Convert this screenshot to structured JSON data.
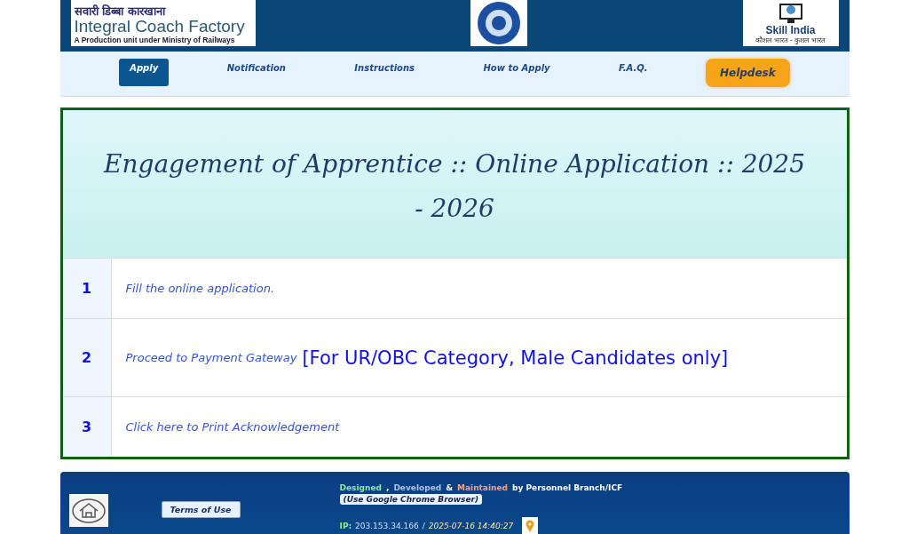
{
  "header": {
    "hindi_title": "सवारी डिब्बा कारखाना",
    "title": "Integral Coach Factory",
    "subtitle": "A Production unit under Ministry of Railways",
    "skill_logo": {
      "name": "Skill India",
      "tagline": "कौशल भारत - कुशल भारत"
    }
  },
  "nav": [
    {
      "label": "Apply",
      "selected": true,
      "kind": "tab"
    },
    {
      "label": "Notification",
      "selected": false,
      "kind": "tab"
    },
    {
      "label": "Instructions",
      "selected": false,
      "kind": "tab"
    },
    {
      "label": "How to Apply",
      "selected": false,
      "kind": "tab"
    },
    {
      "label": "F.A.Q.",
      "selected": false,
      "kind": "tab"
    },
    {
      "label": "Helpdesk",
      "kind": "helpdesk"
    }
  ],
  "main": {
    "title": "Engagement of Apprentice :: Online Application :: 2025 - 2026",
    "steps": [
      {
        "number": "1",
        "link": "Fill the online application."
      },
      {
        "number": "2",
        "link": "Proceed to Payment Gateway",
        "note": "[For UR/OBC Category, Male Candidates only]"
      },
      {
        "number": "3",
        "link": "Click here to Print Acknowledgement"
      }
    ]
  },
  "footer": {
    "terms": "Terms of Use",
    "credits": [
      {
        "text": "Designed",
        "color": "#90ee90"
      },
      {
        "text": ","
      },
      {
        "text": "Developed",
        "color": "#b0c4de"
      },
      {
        "text": "&"
      },
      {
        "text": "Maintained",
        "color": "#ffa07a"
      },
      {
        "text": "by Personnel Branch/ICF",
        "color": "#ffffff"
      }
    ],
    "browser_note": "(Use Google Chrome Browser)",
    "ip_label": "IP:",
    "ip": "203.153.34.166",
    "separator": "/",
    "timestamp": "2025-07-16 14:40:27"
  }
}
